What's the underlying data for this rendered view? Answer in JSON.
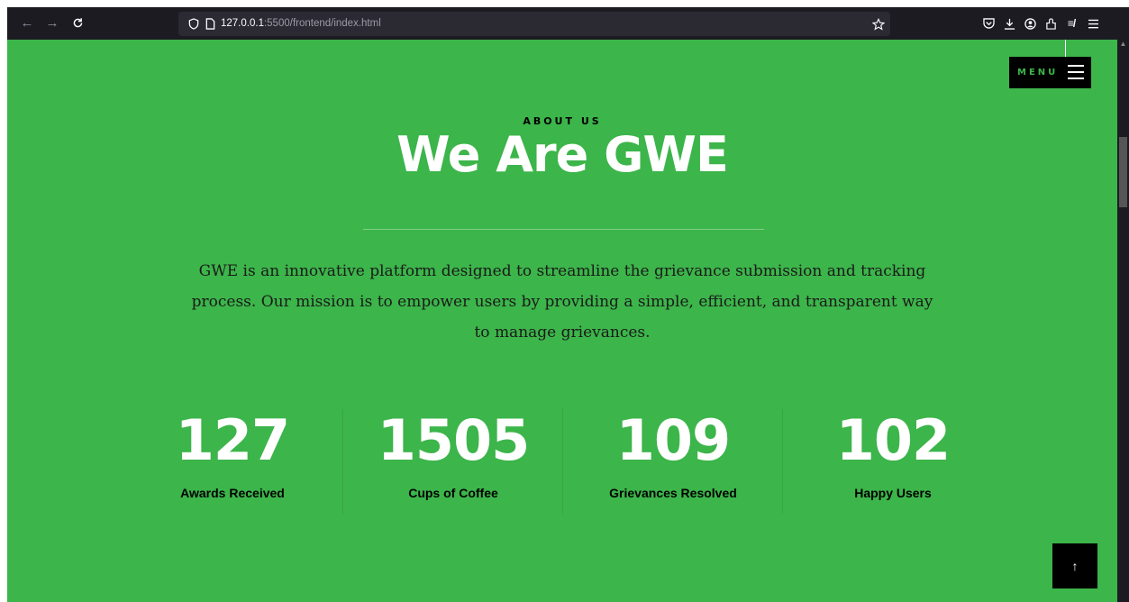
{
  "browser": {
    "url_host": "127.0.0.1",
    "url_path": ":5500/frontend/index.html"
  },
  "menu": {
    "label": "MENU"
  },
  "about": {
    "eyebrow": "ABOUT US",
    "title": "We Are GWE",
    "description": "GWE is an innovative platform designed to streamline the grievance submission and tracking process. Our mission is to empower users by providing a simple, efficient, and transparent way to manage grievances."
  },
  "stats": [
    {
      "value": "127",
      "label": "Awards Received"
    },
    {
      "value": "1505",
      "label": "Cups of Coffee"
    },
    {
      "value": "109",
      "label": "Grievances Resolved"
    },
    {
      "value": "102",
      "label": "Happy Users"
    }
  ],
  "back_to_top": {
    "icon": "↑"
  },
  "colors": {
    "page_background": "#3cb54a",
    "menu_background": "#000000",
    "menu_text": "#3cb54a",
    "browser_toolbar": "#1c1b22"
  }
}
